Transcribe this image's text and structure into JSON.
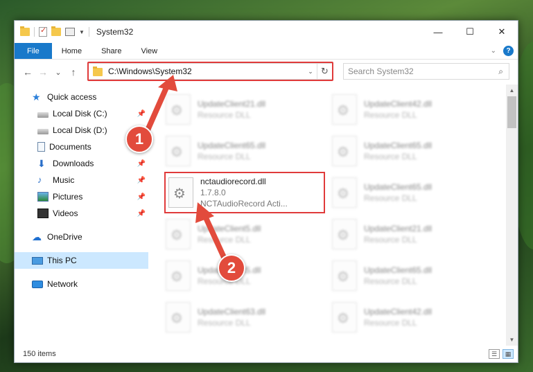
{
  "window": {
    "title": "System32",
    "controls": {
      "minimize": "—",
      "maximize": "☐",
      "close": "✕"
    }
  },
  "ribbon": {
    "tabs": [
      "File",
      "Home",
      "Share",
      "View"
    ],
    "help": "?"
  },
  "navigation": {
    "back": "←",
    "forward": "→",
    "recent": "⌄",
    "up": "↑",
    "address": "C:\\Windows\\System32",
    "address_dropdown": "⌄",
    "refresh": "↻",
    "search_placeholder": "Search System32",
    "search_icon": "⌕"
  },
  "sidebar": {
    "pin": "📌",
    "quick_access": "Quick access",
    "items": [
      {
        "label": "Local Disk (C:)",
        "icon": "disk-icon",
        "pinned": true
      },
      {
        "label": "Local Disk (D:)",
        "icon": "disk-icon",
        "pinned": false
      },
      {
        "label": "Documents",
        "icon": "documents-icon",
        "pinned": true
      },
      {
        "label": "Downloads",
        "icon": "downloads-icon",
        "pinned": true
      },
      {
        "label": "Music",
        "icon": "music-icon",
        "pinned": true
      },
      {
        "label": "Pictures",
        "icon": "pictures-icon",
        "pinned": true
      },
      {
        "label": "Videos",
        "icon": "videos-icon",
        "pinned": true
      }
    ],
    "onedrive": "OneDrive",
    "this_pc": "This PC",
    "network": "Network"
  },
  "files": {
    "highlighted": {
      "name": "nctaudiorecord.dll",
      "version": "1.7.8.0",
      "description": "NCTAudioRecord Acti..."
    },
    "left_column": [
      {
        "name": "UpdateClient21.dll",
        "type": "Resource DLL"
      },
      {
        "name": "UpdateClient65.dll",
        "type": "Resource DLL"
      },
      {
        "name": "UpdateClient5.dll",
        "type": "Resource DLL"
      },
      {
        "name": "UpdateClient5.dll",
        "type": "Resource DLL"
      },
      {
        "name": "UpdateClient63.dll",
        "type": "Resource DLL"
      }
    ],
    "right_column": [
      {
        "name": "UpdateClient42.dll",
        "type": "Resource DLL"
      },
      {
        "name": "UpdateClient65.dll",
        "type": "Resource DLL"
      },
      {
        "name": "UpdateClient65.dll",
        "type": "Resource DLL"
      },
      {
        "name": "UpdateClient21.dll",
        "type": "Resource DLL"
      },
      {
        "name": "UpdateClient65.dll",
        "type": "Resource DLL"
      },
      {
        "name": "UpdateClient42.dll",
        "type": "Resource DLL"
      }
    ]
  },
  "status": {
    "item_count": "150 items"
  },
  "annotations": {
    "step1": "1",
    "step2": "2",
    "color": "#e24b3c"
  }
}
